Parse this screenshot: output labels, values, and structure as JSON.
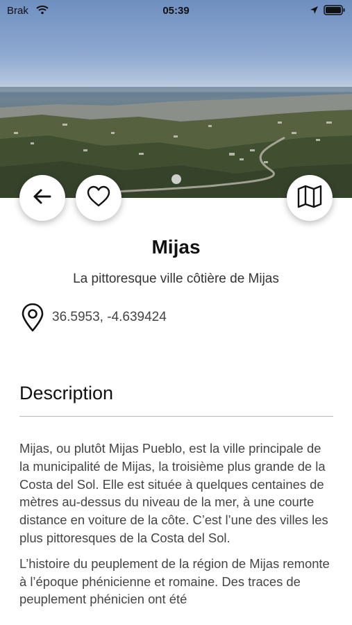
{
  "status_bar": {
    "carrier": "Brak",
    "time": "05:39",
    "icons": [
      "wifi-icon",
      "location-arrow-icon",
      "battery-icon"
    ]
  },
  "hero": {
    "image": "aerial-landscape-photo",
    "pagination": {
      "current": 1,
      "total": 1
    }
  },
  "actions": {
    "back": "arrow-left-icon",
    "favorite": "heart-outline-icon",
    "map": "map-icon"
  },
  "place": {
    "name": "Mijas",
    "tagline": "La pittoresque ville côtière de Mijas",
    "coordinates": "36.5953, -4.639424"
  },
  "description": {
    "heading": "Description",
    "paragraphs": [
      "Mijas, ou plutôt Mijas Pueblo, est la ville principale de la municipalité de Mijas, la troisième plus grande de la Costa del Sol. Elle est située à quelques centaines de mètres au-dessus du niveau de la mer, à une courte distance en voiture de la côte. C’est l’une des villes les plus pittoresques de la Costa del Sol.",
      "L’histoire du peuplement de la région de Mijas remonte à l’époque phénicienne et romaine. Des traces de peuplement phénicien ont été"
    ]
  },
  "colors": {
    "background": "#ffffff",
    "text_primary": "#111111",
    "text_secondary": "#444444",
    "divider": "#b8b8b8"
  }
}
